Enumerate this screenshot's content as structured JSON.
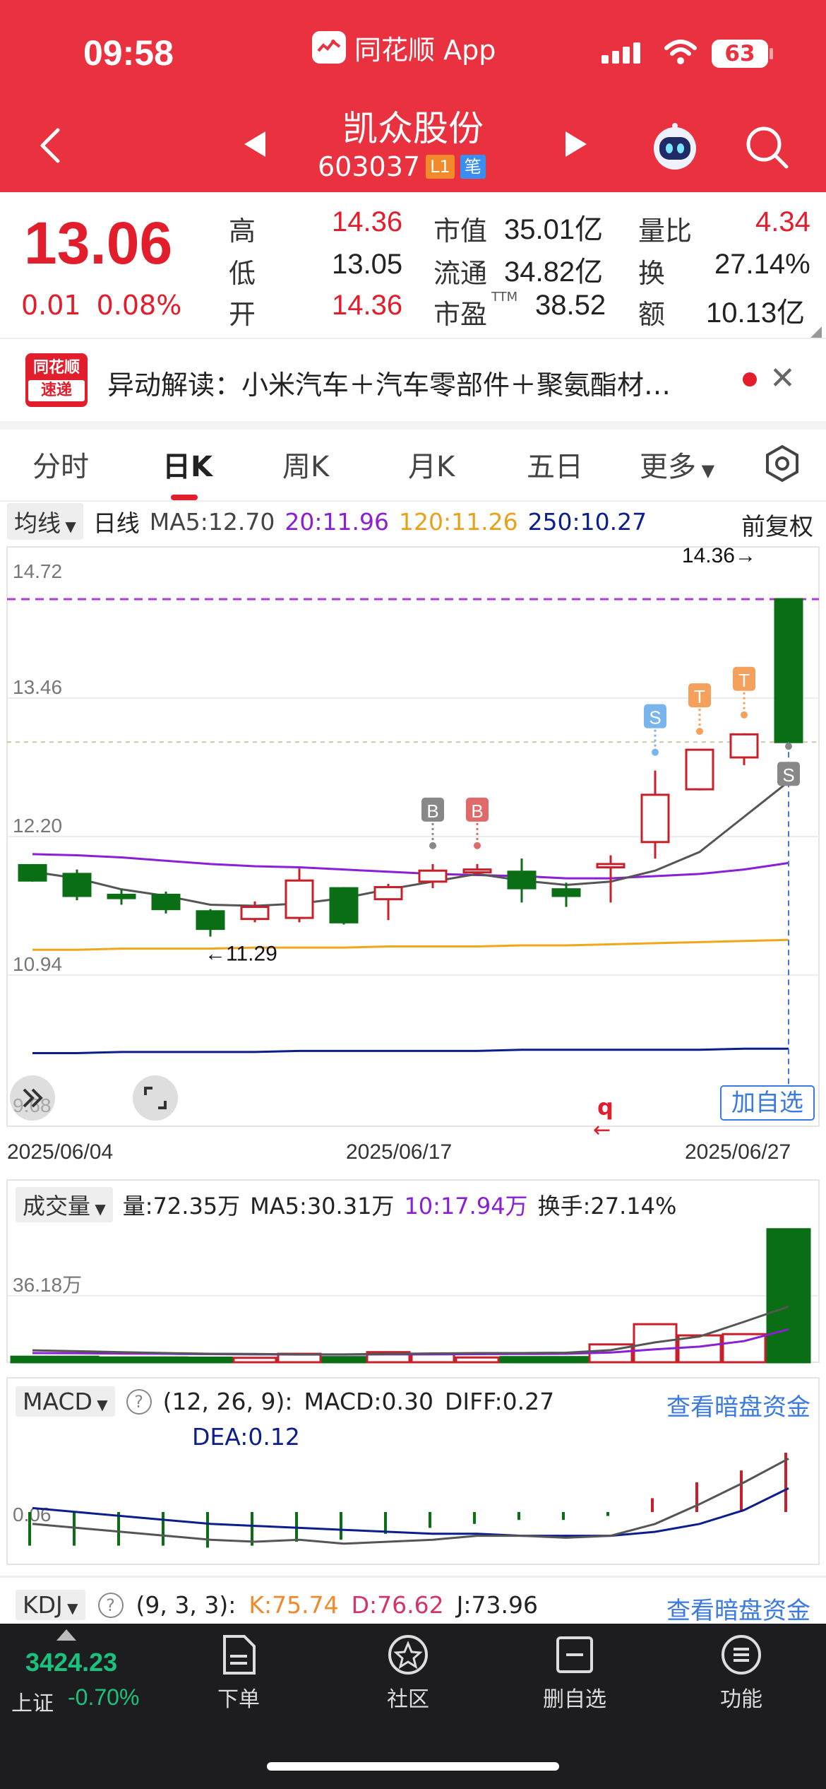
{
  "status_bar": {
    "time": "09:58",
    "app_name": "同花顺 App",
    "battery": "63"
  },
  "header": {
    "stock_name": "凯众股份",
    "stock_code": "603037",
    "tag_l1": "L1",
    "tag_bi": "笔"
  },
  "quote": {
    "price": "13.06",
    "change": "0.01",
    "change_pct": "0.08%",
    "high_label": "高",
    "high": "14.36",
    "low_label": "低",
    "low": "13.05",
    "open_label": "开",
    "open": "14.36",
    "mcap_label": "市值",
    "mcap": "35.01亿",
    "float_label": "流通",
    "float": "34.82亿",
    "pe_label": "市盈",
    "pe_sup": "TTM",
    "pe": "38.52",
    "vr_label": "量比",
    "vr": "4.34",
    "turnover_label": "换",
    "turnover": "27.14%",
    "amount_label": "额",
    "amount": "10.13亿"
  },
  "news": {
    "logo_line1": "同花顺",
    "logo_line2": "速递",
    "text": "异动解读：小米汽车＋汽车零部件＋聚氨酯材…"
  },
  "tabs": [
    "分时",
    "日K",
    "周K",
    "月K",
    "五日",
    "更多"
  ],
  "ma_row": {
    "dropdown": "均线",
    "period": "日线",
    "ma5": "MA5:12.70",
    "ma20": "20:11.96",
    "ma120": "120:11.26",
    "ma250": "250:10.27",
    "adjust": "前复权"
  },
  "chart_data": [
    {
      "type": "candlestick",
      "title": "日K",
      "y_ticks": [
        "14.72",
        "13.46",
        "12.20",
        "10.94",
        "9.68"
      ],
      "ylim": [
        9.68,
        14.72
      ],
      "dates_shown": [
        "2025/06/04",
        "2025/06/17",
        "2025/06/27"
      ],
      "candles": [
        {
          "open": 11.94,
          "close": 11.8,
          "high": 11.95,
          "low": 11.79
        },
        {
          "open": 11.86,
          "close": 11.66,
          "high": 11.9,
          "low": 11.62
        },
        {
          "open": 11.67,
          "close": 11.64,
          "high": 11.72,
          "low": 11.58
        },
        {
          "open": 11.67,
          "close": 11.54,
          "high": 11.7,
          "low": 11.5
        },
        {
          "open": 11.52,
          "close": 11.36,
          "high": 11.54,
          "low": 11.29
        },
        {
          "open": 11.45,
          "close": 11.56,
          "high": 11.61,
          "low": 11.42
        },
        {
          "open": 11.46,
          "close": 11.8,
          "high": 11.91,
          "low": 11.42
        },
        {
          "open": 11.73,
          "close": 11.42,
          "high": 11.74,
          "low": 11.4
        },
        {
          "open": 11.63,
          "close": 11.74,
          "high": 11.77,
          "low": 11.44
        },
        {
          "open": 11.79,
          "close": 11.89,
          "high": 11.95,
          "low": 11.73
        },
        {
          "open": 11.89,
          "close": 11.9,
          "high": 11.95,
          "low": 11.85
        },
        {
          "open": 11.88,
          "close": 11.73,
          "high": 12.0,
          "low": 11.6
        },
        {
          "open": 11.72,
          "close": 11.66,
          "high": 11.78,
          "low": 11.56
        },
        {
          "open": 11.92,
          "close": 11.95,
          "high": 12.03,
          "low": 11.6
        },
        {
          "open": 12.15,
          "close": 12.58,
          "high": 12.8,
          "low": 12.0
        },
        {
          "open": 12.63,
          "close": 12.99,
          "high": 12.99,
          "low": 12.62
        },
        {
          "open": 12.92,
          "close": 13.13,
          "high": 13.14,
          "low": 12.85
        },
        {
          "open": 14.36,
          "close": 13.06,
          "high": 14.36,
          "low": 13.05
        }
      ],
      "ma5": [
        11.88,
        11.82,
        11.72,
        11.66,
        11.58,
        11.57,
        11.59,
        11.64,
        11.72,
        11.79,
        11.86,
        11.8,
        11.76,
        11.79,
        11.89,
        12.06,
        12.38,
        12.7
      ],
      "ma20": [
        12.04,
        12.03,
        12.01,
        11.98,
        11.95,
        11.93,
        11.92,
        11.9,
        11.88,
        11.86,
        11.85,
        11.84,
        11.82,
        11.82,
        11.84,
        11.86,
        11.9,
        11.96
      ],
      "ma120": [
        11.17,
        11.17,
        11.18,
        11.18,
        11.18,
        11.19,
        11.19,
        11.19,
        11.2,
        11.2,
        11.2,
        11.21,
        11.21,
        11.22,
        11.23,
        11.24,
        11.25,
        11.26
      ],
      "ma250": [
        10.23,
        10.23,
        10.24,
        10.24,
        10.24,
        10.24,
        10.25,
        10.25,
        10.25,
        10.25,
        10.25,
        10.26,
        10.26,
        10.26,
        10.26,
        10.26,
        10.27,
        10.27
      ],
      "annotations": {
        "max_label": "14.36→",
        "min_label": "←11.29",
        "marks": [
          "B",
          "B",
          "S",
          "T",
          "T",
          "S"
        ]
      }
    },
    {
      "type": "bar",
      "title": "成交量",
      "y_ticks": [
        "36.18万"
      ],
      "values": [
        3.0,
        3.0,
        2.6,
        2.6,
        2.5,
        2.4,
        4.6,
        2.8,
        5.5,
        4.4,
        2.6,
        2.8,
        2.8,
        9.7,
        20.7,
        14.6,
        15.3,
        72.35
      ],
      "ma5": [
        6.5,
        6.0,
        5.5,
        5.0,
        4.6,
        4.5,
        4.3,
        4.3,
        4.5,
        4.8,
        5.0,
        5.0,
        5.2,
        6.6,
        10.8,
        14.0,
        22.0,
        30.31
      ],
      "ma10": [
        5.0,
        4.9,
        4.7,
        4.6,
        4.4,
        4.3,
        4.2,
        4.2,
        4.3,
        4.3,
        4.4,
        4.5,
        4.6,
        5.3,
        7.0,
        8.5,
        11.5,
        17.94
      ]
    },
    {
      "type": "bar",
      "title": "MACD",
      "y_ticks": [
        "0.06"
      ],
      "values": [
        -0.17,
        -0.17,
        -0.17,
        -0.17,
        -0.18,
        -0.17,
        -0.15,
        -0.14,
        -0.11,
        -0.08,
        -0.06,
        -0.04,
        -0.04,
        -0.02,
        0.07,
        0.15,
        0.21,
        0.3
      ],
      "diff": [
        -0.06,
        -0.08,
        -0.1,
        -0.12,
        -0.14,
        -0.15,
        -0.14,
        -0.16,
        -0.15,
        -0.14,
        -0.12,
        -0.12,
        -0.13,
        -0.12,
        -0.06,
        0.04,
        0.15,
        0.27
      ],
      "dea": [
        0.02,
        0.0,
        -0.02,
        -0.04,
        -0.06,
        -0.07,
        -0.08,
        -0.09,
        -0.1,
        -0.11,
        -0.11,
        -0.12,
        -0.12,
        -0.12,
        -0.1,
        -0.06,
        0.01,
        0.12
      ]
    }
  ],
  "volume": {
    "dropdown": "成交量",
    "vol": "量:72.35万",
    "ma5": "MA5:30.31万",
    "ma10": "10:17.94万",
    "turnover": "换手:27.14%"
  },
  "macd": {
    "dropdown": "MACD",
    "params": "(12, 26, 9):",
    "macd": "MACD:0.30",
    "diff": "DIFF:0.27",
    "dea": "DEA:0.12",
    "link": "查看暗盘资金"
  },
  "kdj": {
    "dropdown": "KDJ",
    "params": "(9, 3, 3):",
    "k": "K:75.74",
    "d": "D:76.62",
    "j": "J:73.96",
    "link": "查看暗盘资金"
  },
  "buttons": {
    "add_watch": "加自选",
    "q_mark": "q"
  },
  "bottom_nav": {
    "index_value": "3424.23",
    "index_name": "上证",
    "index_change": "-0.70%",
    "items": [
      "下单",
      "社区",
      "删自选",
      "功能"
    ]
  },
  "colors": {
    "up": "#c8202b",
    "down": "#0a6e14",
    "brand_red": "#e9313f",
    "ma5": "#555555",
    "ma20": "#8a1fd6",
    "ma120": "#f0a81a",
    "ma250": "#0b1e8c",
    "link": "#3b7ae0"
  }
}
